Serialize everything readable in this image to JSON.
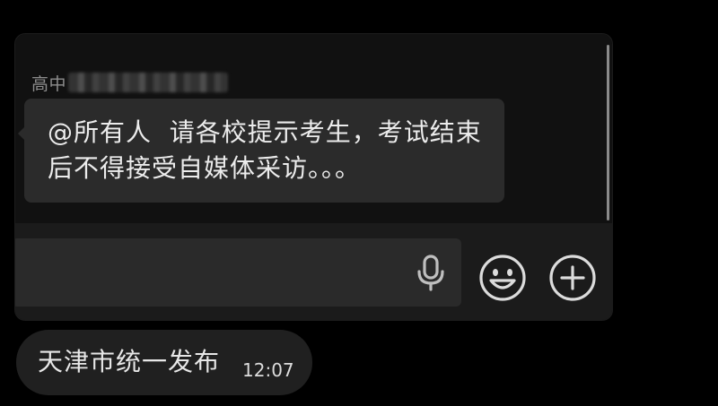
{
  "chat": {
    "sender_prefix": "高中",
    "message_text": "@所有人  请各校提示考生，考试结束后不得接受自媒体采访。。。"
  },
  "input_bar": {
    "icons": [
      "mic-icon",
      "emoji-icon",
      "plus-icon"
    ]
  },
  "channel_post": {
    "text": "天津市统一发布",
    "time": "12:07"
  },
  "colors": {
    "background": "#000000",
    "card": "#111111",
    "bubble": "#2b2b2b",
    "input_bar": "#1b1b1b",
    "input_field": "#2a2a2a",
    "icon": "#bfbfbf"
  }
}
